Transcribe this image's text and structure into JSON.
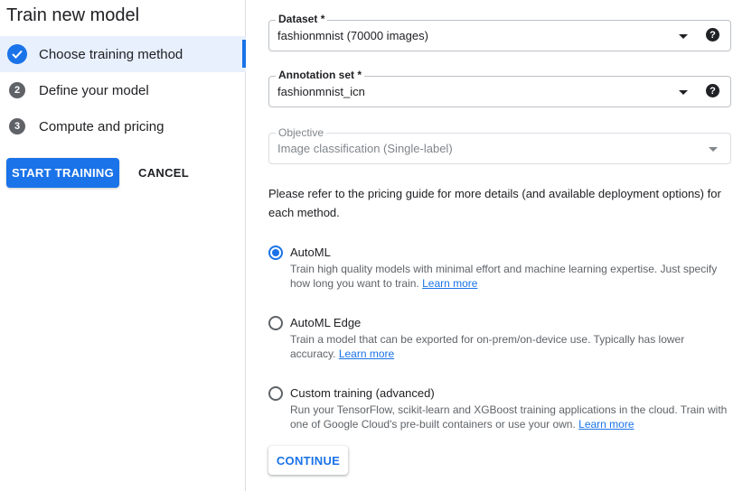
{
  "panel": {
    "title": "Train new model",
    "steps": [
      {
        "label": "Choose training method",
        "number": "",
        "state": "done"
      },
      {
        "label": "Define your model",
        "number": "2",
        "state": "pending"
      },
      {
        "label": "Compute and pricing",
        "number": "3",
        "state": "pending"
      }
    ],
    "start_label": "START TRAINING",
    "cancel_label": "CANCEL"
  },
  "form": {
    "dataset": {
      "label": "Dataset *",
      "value": "fashionmnist (70000 images)"
    },
    "annotation_set": {
      "label": "Annotation set *",
      "value": "fashionmnist_icn"
    },
    "objective": {
      "label": "Objective",
      "value": "Image classification (Single-label)",
      "disabled": true
    },
    "help_glyph": "?",
    "info_text": "Please refer to the pricing guide for more details (and available deployment options) for each method.",
    "options": [
      {
        "title": "AutoML",
        "description": "Train high quality models with minimal effort and machine learning expertise. Just specify how long you want to train.",
        "link": "Learn more",
        "selected": true
      },
      {
        "title": "AutoML Edge",
        "description": "Train a model that can be exported for on-prem/on-device use. Typically has lower accuracy.",
        "link": "Learn more",
        "selected": false
      },
      {
        "title": "Custom training (advanced)",
        "description": "Run your TensorFlow, scikit-learn and XGBoost training applications in the cloud. Train with one of Google Cloud's pre-built containers or use your own.",
        "link": "Learn more",
        "selected": false
      }
    ],
    "continue_label": "CONTINUE"
  },
  "colors": {
    "accent": "#1a73e8",
    "active_bg": "#e8f0fe",
    "step_gray": "#5f6368"
  },
  "icons": {
    "step_done": "check-circle-icon",
    "dropdown": "chevron-down-icon",
    "help": "help-circle-icon"
  }
}
